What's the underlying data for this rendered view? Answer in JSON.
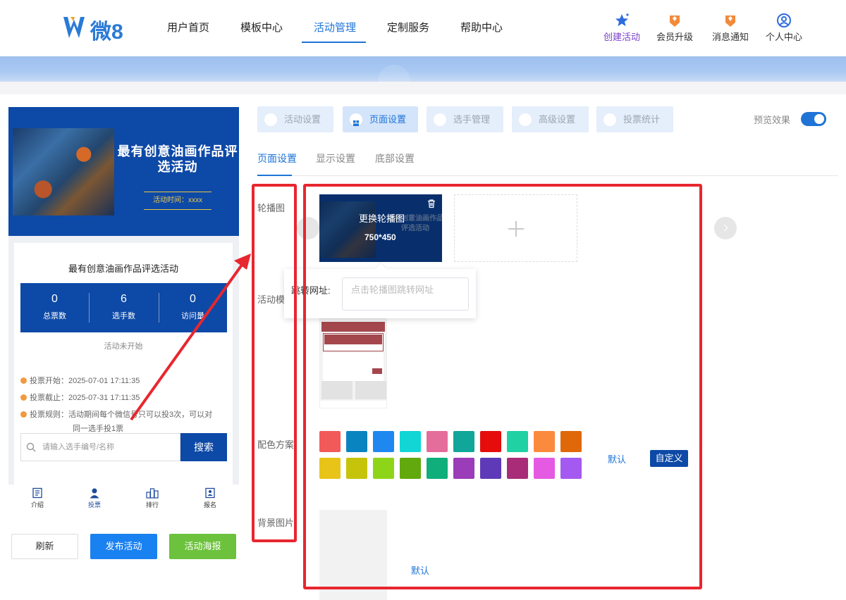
{
  "header": {
    "logo_text": "微8",
    "nav": [
      "用户首页",
      "模板中心",
      "活动管理",
      "定制服务",
      "帮助中心"
    ],
    "active_nav": "活动管理",
    "actions": [
      "创建活动",
      "会员升级",
      "消息通知",
      "个人中心"
    ]
  },
  "preview": {
    "banner_title": "最有创意油画作品评选活动",
    "banner_time": "活动时间：xxxx",
    "card_title": "最有创意油画作品评选活动",
    "stats": [
      {
        "num": "0",
        "label": "总票数"
      },
      {
        "num": "6",
        "label": "选手数"
      },
      {
        "num": "0",
        "label": "访问量"
      }
    ],
    "status": "活动未开始",
    "vote_start": "投票开始：2025-07-01 17:11:35",
    "vote_end": "投票截止：2025-07-31 17:11:35",
    "vote_rule_1": "投票规则：活动期间每个微信号只可以投3次，可以对",
    "vote_rule_2": "同一选手投1票",
    "search_placeholder": "请输入选手编号/名称",
    "search_button": "搜索",
    "tabbar": [
      "介绍",
      "投票",
      "排行",
      "报名"
    ]
  },
  "buttons": {
    "refresh": "刷新",
    "publish": "发布活动",
    "poster": "活动海报"
  },
  "top_tabs": [
    "活动设置",
    "页面设置",
    "选手管理",
    "高级设置",
    "投票统计"
  ],
  "active_top_tab": "页面设置",
  "preview_toggle": {
    "label": "预览效果",
    "on": true
  },
  "sub_tabs": [
    "页面设置",
    "显示设置",
    "底部设置"
  ],
  "active_sub_tab": "页面设置",
  "fields": {
    "carousel": "轮播图",
    "template": "活动模",
    "color_scheme": "配色方案",
    "background": "背景图片"
  },
  "carousel": {
    "change_text": "更换轮播图",
    "size_text": "750*450",
    "img_title": "最有创意油画作品评选活动"
  },
  "popup": {
    "label": "跳转网址:",
    "placeholder": "点击轮播图跳转网址"
  },
  "colors": {
    "row1": [
      "#f25a5a",
      "#0a84c0",
      "#1e88f0",
      "#12d6d6",
      "#e56d9b",
      "#10a69a",
      "#e60c0c",
      "#1fd1a3",
      "#fb8a3e",
      "#e06808"
    ],
    "row2": [
      "#e9c418",
      "#c6c40a",
      "#8ed51a",
      "#62a90e",
      "#0fae7a",
      "#9b3cb8",
      "#5e3ab8",
      "#a82c78",
      "#e55ae2",
      "#a45af0"
    ]
  },
  "scheme_default": "默认",
  "scheme_custom": "自定义",
  "background_default": "默认"
}
